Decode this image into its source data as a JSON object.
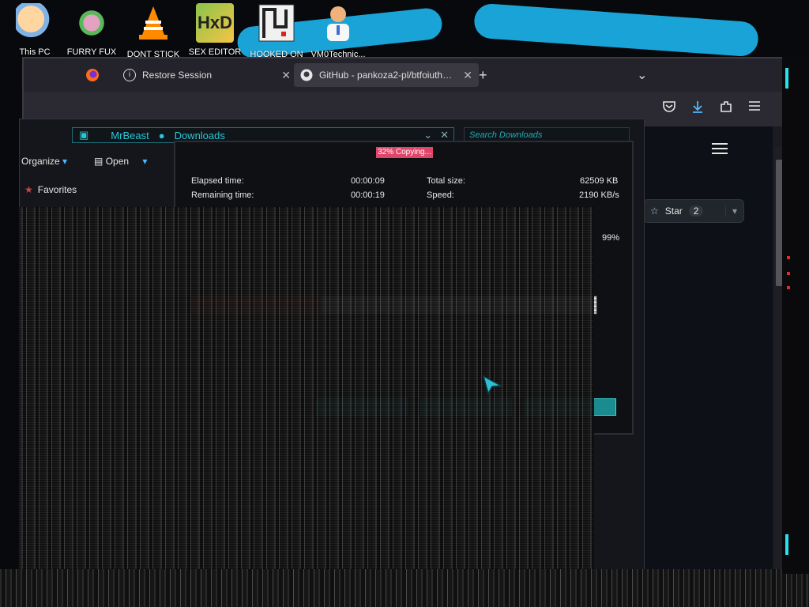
{
  "desktop": {
    "icons": [
      {
        "label": "This PC",
        "icon": "pc-avatar-icon"
      },
      {
        "label": "FURRY FUX",
        "icon": "furry-icon"
      },
      {
        "label": "DONT STICK",
        "icon": "vlc-cone-icon"
      },
      {
        "label": "SEX EDITOR",
        "icon": "hxd-editor-icon"
      },
      {
        "label": "HOOKED ON",
        "icon": "maze-icon"
      },
      {
        "label": "VM0Technic...",
        "icon": "doctor-icon"
      }
    ],
    "accent": "#1aa3d6"
  },
  "browser": {
    "tabs": [
      {
        "label": "Restore Session",
        "icon": "info-icon"
      },
      {
        "label": "GitHub - pankoza2-pl/btfoiuth…",
        "icon": "github-icon"
      }
    ],
    "new_tab_symbol": "+",
    "tab_list_symbol": "⌄",
    "toolbar_icons": [
      "pocket-icon",
      "download-icon",
      "extensions-icon",
      "menu-icon"
    ],
    "github": {
      "star_label": "Star",
      "star_count": "2",
      "menu_icon": "hamburger-icon"
    }
  },
  "explorer": {
    "address": {
      "crumbs": [
        "MrBeast",
        "Downloads"
      ]
    },
    "search_placeholder": "Search Downloads",
    "commands": {
      "organize": "Organize",
      "open": "Open"
    },
    "nav": {
      "favorites": "Favorites"
    }
  },
  "copy_dialog": {
    "title": "32% Copying...",
    "elapsed_label": "Elapsed time:",
    "elapsed_value": "00:00:09",
    "remaining_label": "Remaining time:",
    "remaining_value": "00:00:19",
    "total_size_label": "Total size:",
    "total_size_value": "62509 KB",
    "speed_label": "Speed:",
    "speed_value": "2190 KB/s",
    "extra_values": [
      "99%"
    ],
    "progress_fraction": 0.32,
    "colors": {
      "progress": "#c33939",
      "button": "#1a8b8f",
      "title": "#e0466a"
    }
  }
}
